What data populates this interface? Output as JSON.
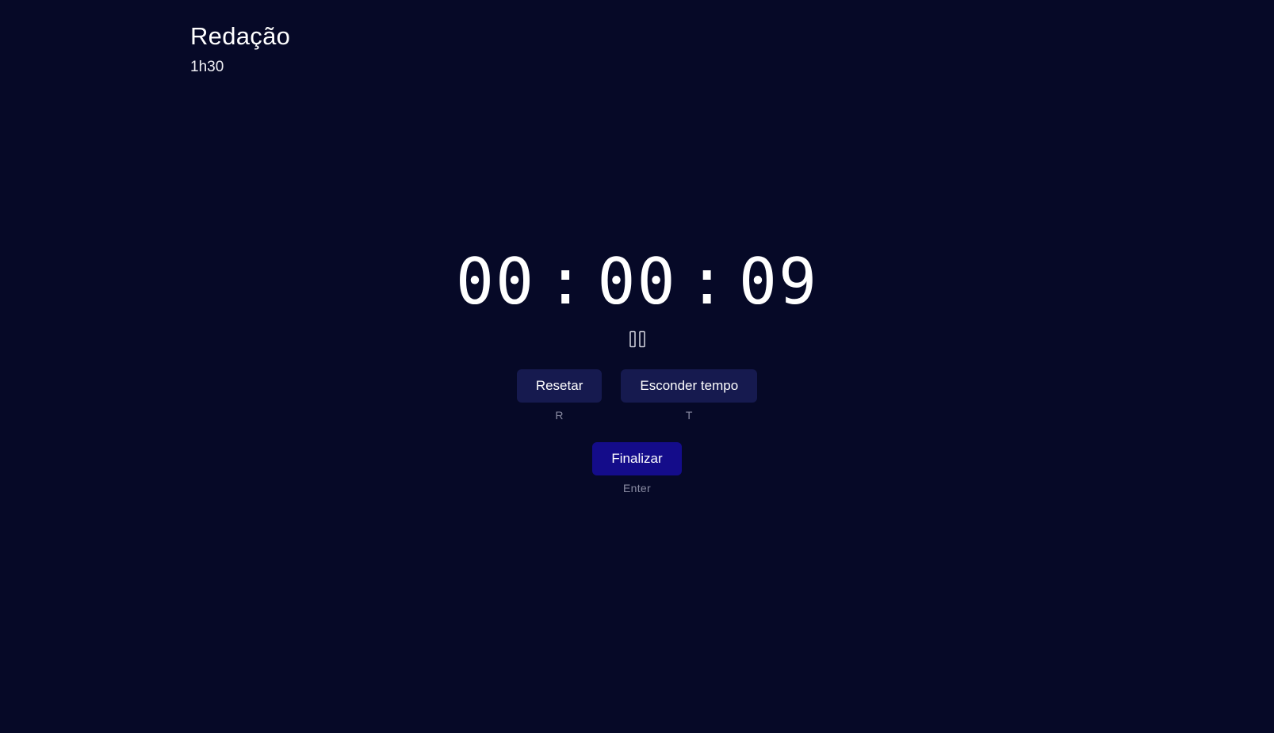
{
  "header": {
    "title": "Redação",
    "duration": "1h30"
  },
  "timer": {
    "hours": "00",
    "minutes": "00",
    "seconds": "09",
    "separator": ":"
  },
  "controls": {
    "pause_icon": "pause-icon",
    "reset_label": "Resetar",
    "reset_shortcut": "R",
    "hide_label": "Esconder tempo",
    "hide_shortcut": "T",
    "finish_label": "Finalizar",
    "finish_shortcut": "Enter"
  },
  "colors": {
    "background": "#060927",
    "secondary_button": "#161a4f",
    "primary_button": "#140c8a",
    "shortcut_text": "#8a8ca3"
  }
}
